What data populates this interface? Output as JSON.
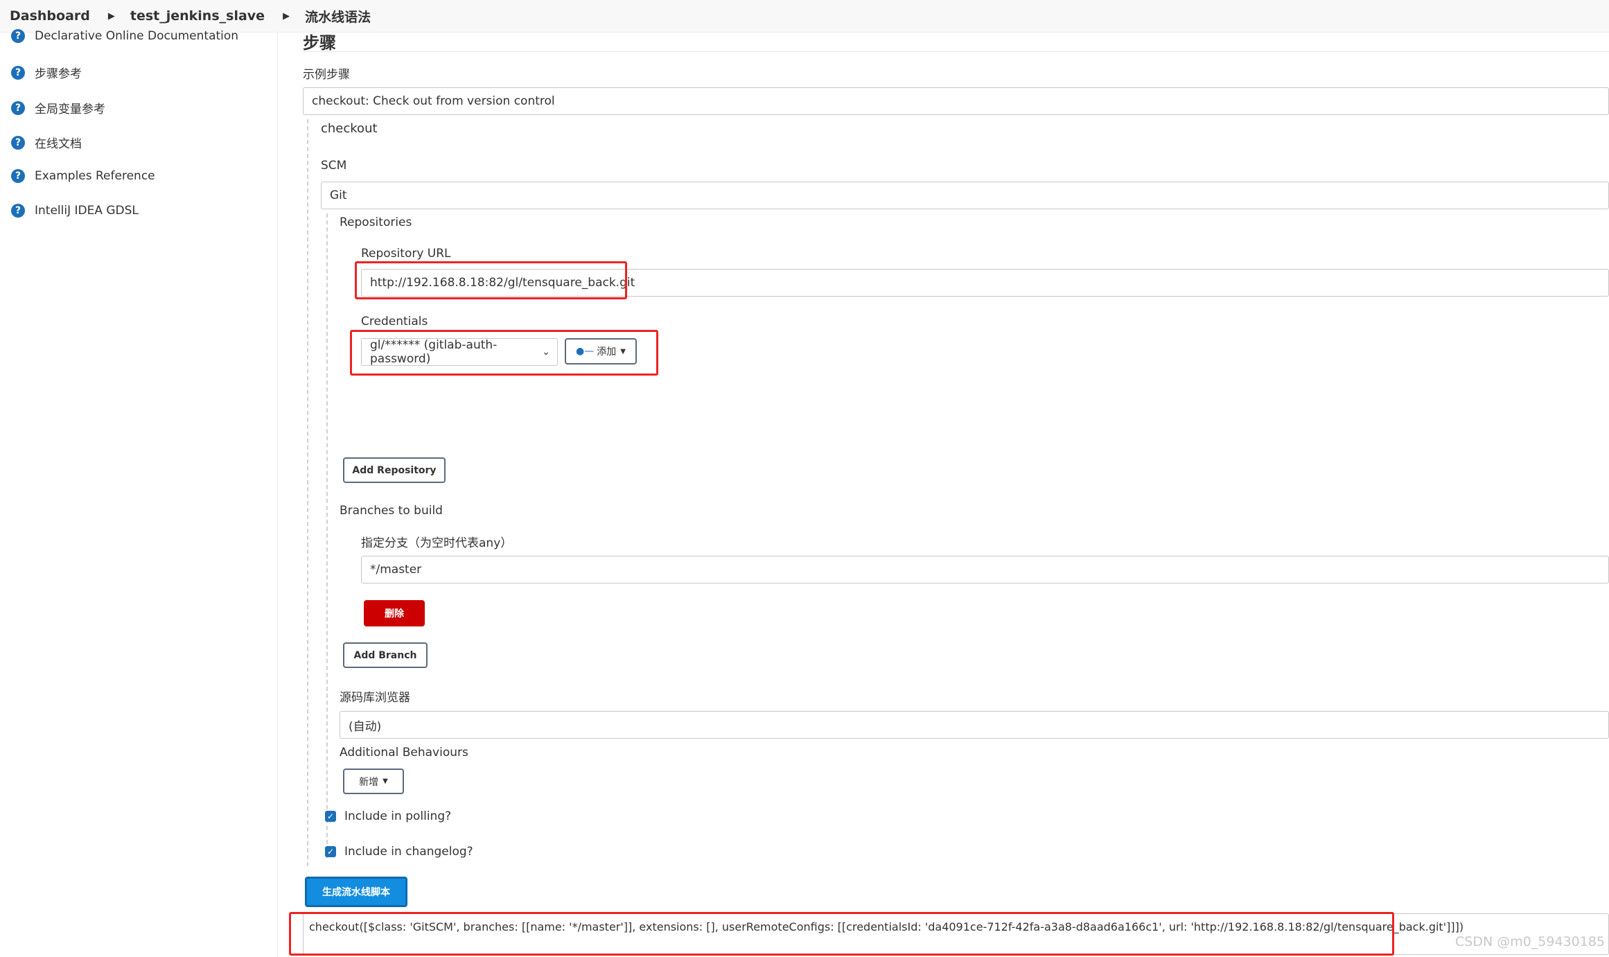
{
  "breadcrumb": [
    "Dashboard",
    "test_jenkins_slave",
    "流水线语法"
  ],
  "sidebar": {
    "items": [
      {
        "label": "Declarative Online Documentation",
        "icon": "help-icon"
      },
      {
        "label": "步骤参考",
        "icon": "help-icon"
      },
      {
        "label": "全局变量参考",
        "icon": "help-icon"
      },
      {
        "label": "在线文档",
        "icon": "help-icon"
      },
      {
        "label": "Examples Reference",
        "icon": "help-icon"
      },
      {
        "label": "IntelliJ IDEA GDSL",
        "icon": "help-icon"
      }
    ]
  },
  "main": {
    "section_title": "步骤",
    "sample_step_label": "示例步骤",
    "sample_step_value": "checkout: Check out from version control",
    "checkout_label": "checkout",
    "scm_label": "SCM",
    "scm_value": "Git",
    "repositories_label": "Repositories",
    "repo_url_label": "Repository URL",
    "repo_url_value": "http://192.168.8.18:82/gl/tensquare_back.git",
    "credentials_label": "Credentials",
    "credentials_value": "gl/****** (gitlab-auth-password)",
    "add_credentials_label": "添加",
    "add_repository_label": "Add Repository",
    "branches_label": "Branches to build",
    "branch_spec_label": "指定分支（为空时代表any）",
    "branch_spec_value": "*/master",
    "delete_label": "删除",
    "add_branch_label": "Add Branch",
    "browser_label": "源码库浏览器",
    "browser_value": "(自动)",
    "additional_behaviours_label": "Additional Behaviours",
    "add_behaviour_label": "新增",
    "include_polling_label": "Include in polling?",
    "include_changelog_label": "Include in changelog?",
    "generate_label": "生成流水线脚本",
    "script_output": "checkout([$class: 'GitSCM', branches: [[name: '*/master']], extensions: [], userRemoteConfigs: [[credentialsId: 'da4091ce-712f-42fa-a3a8-d8aad6a166c1', url: 'http://192.168.8.18:82/gl/tensquare_back.git']]])"
  },
  "watermark": "CSDN @m0_59430185",
  "colors": {
    "accent": "#1d6fb8",
    "danger": "#cc0000",
    "highlight": "#ee2222"
  }
}
